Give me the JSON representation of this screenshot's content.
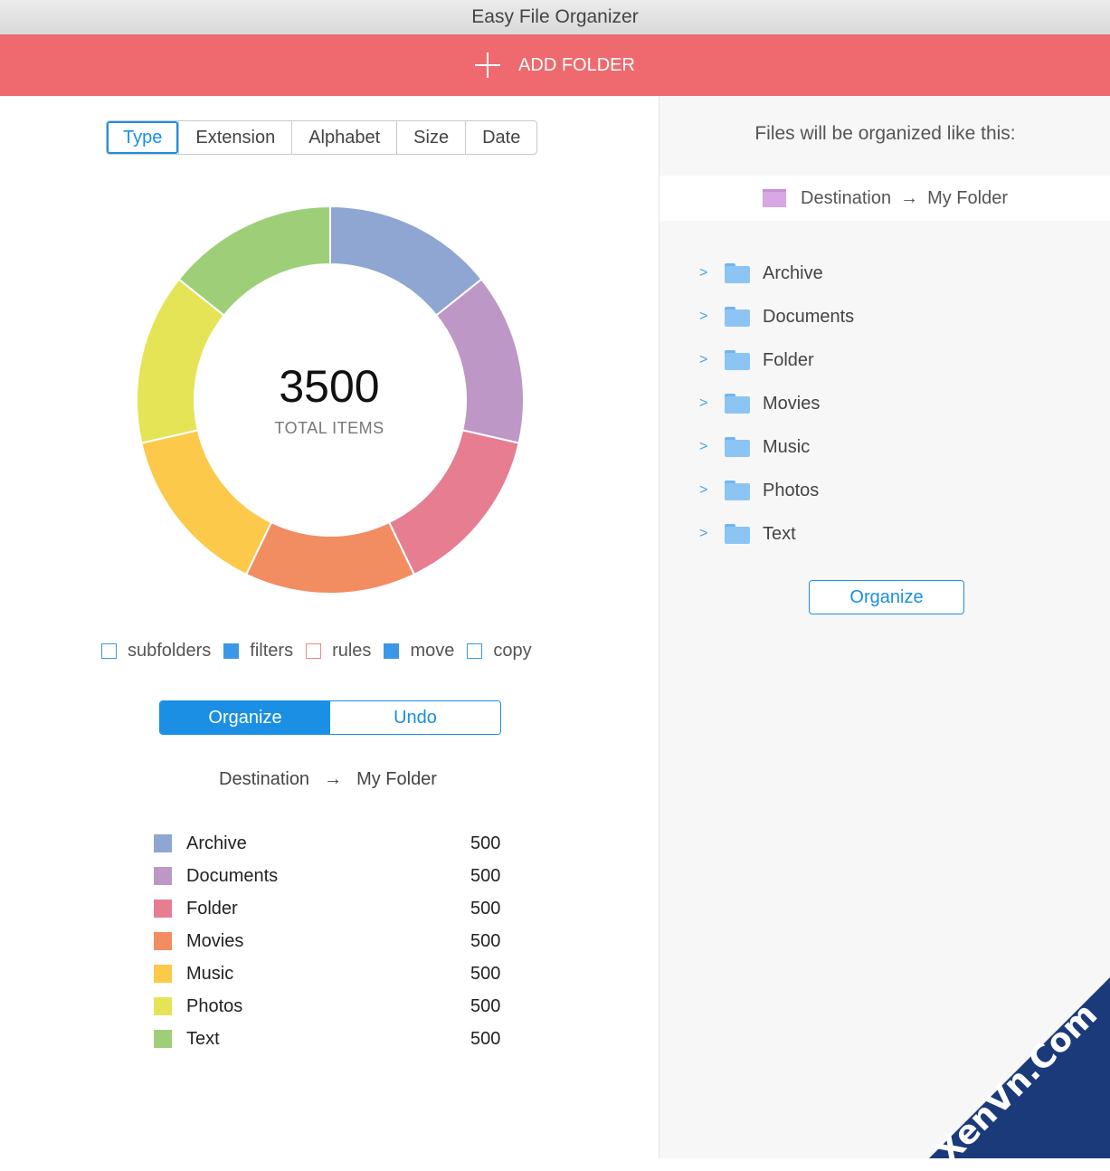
{
  "window": {
    "title": "Easy File Organizer"
  },
  "toolbar": {
    "add_folder_label": "ADD FOLDER"
  },
  "tabs": [
    "Type",
    "Extension",
    "Alphabet",
    "Size",
    "Date"
  ],
  "summary": {
    "total": "3500",
    "total_label": "TOTAL ITEMS"
  },
  "options": [
    {
      "label": "subfolders",
      "checked": false
    },
    {
      "label": "filters",
      "checked": true
    },
    {
      "label": "rules",
      "checked": false
    },
    {
      "label": "move",
      "checked": true
    },
    {
      "label": "copy",
      "checked": false
    }
  ],
  "actions": {
    "organize_label": "Organize",
    "undo_label": "Undo"
  },
  "destination": {
    "from": "Destination",
    "to": "My Folder"
  },
  "categories": [
    {
      "name": "Archive",
      "count": "500",
      "color": "#8ea6d1"
    },
    {
      "name": "Documents",
      "count": "500",
      "color": "#bd97c6"
    },
    {
      "name": "Folder",
      "count": "500",
      "color": "#e67d91"
    },
    {
      "name": "Movies",
      "count": "500",
      "color": "#f28d62"
    },
    {
      "name": "Music",
      "count": "500",
      "color": "#fdc94a"
    },
    {
      "name": "Photos",
      "count": "500",
      "color": "#e5e457"
    },
    {
      "name": "Text",
      "count": "500",
      "color": "#9ecf78"
    }
  ],
  "chart_data": {
    "type": "pie",
    "categories": [
      "Archive",
      "Documents",
      "Folder",
      "Movies",
      "Music",
      "Photos",
      "Text"
    ],
    "values": [
      500,
      500,
      500,
      500,
      500,
      500,
      500
    ]
  },
  "preview": {
    "heading": "Files will be organized like this:",
    "destination_from": "Destination",
    "destination_to": "My Folder",
    "folders": [
      "Archive",
      "Documents",
      "Folder",
      "Movies",
      "Music",
      "Photos",
      "Text"
    ],
    "organize_label": "Organize"
  },
  "watermark": {
    "text": "XenVn.Com"
  }
}
